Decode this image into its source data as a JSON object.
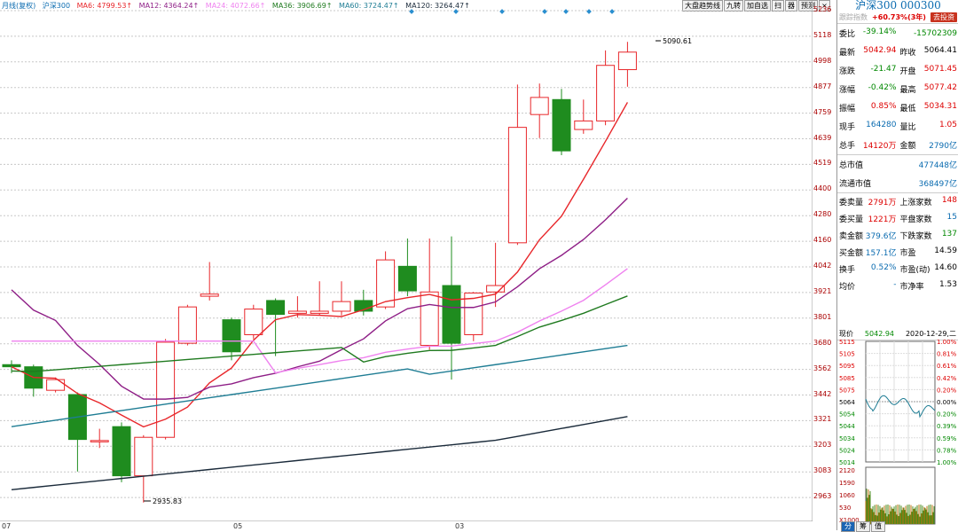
{
  "legend": {
    "period": "月线(复权)",
    "name": "沪深300",
    "ma6": "MA6: 4799.53↑",
    "ma12": "MA12: 4364.24↑",
    "ma24": "MA24: 4072.66↑",
    "ma36": "MA36: 3906.69↑",
    "ma60": "MA60: 3724.47↑",
    "ma120": "MA120: 3264.47↑"
  },
  "toolbar": {
    "btn1": "大盘趋势线",
    "btn2": "九转",
    "btn3": "加自选",
    "btn4": "扫",
    "btn5": "器",
    "btn6": "预测",
    "close": "×"
  },
  "price_axis": [
    "5236",
    "5118",
    "4998",
    "4877",
    "4759",
    "4639",
    "4519",
    "4400",
    "4280",
    "4160",
    "4042",
    "3921",
    "3801",
    "3680",
    "3562",
    "3442",
    "3321",
    "3203",
    "3083",
    "2963"
  ],
  "x_labels": {
    "a": "07",
    "b": "05",
    "c": "03"
  },
  "annotations": {
    "high": "5090.61",
    "low": "2935.83"
  },
  "chart_data": {
    "type": "candlestick",
    "ylim": [
      2900,
      5240
    ],
    "candles": [
      {
        "o": 3580,
        "c": 3570,
        "h": 3600,
        "l": 3540
      },
      {
        "o": 3570,
        "c": 3470,
        "h": 3580,
        "l": 3430
      },
      {
        "o": 3460,
        "c": 3510,
        "h": 3520,
        "l": 3450
      },
      {
        "o": 3440,
        "c": 3230,
        "h": 3450,
        "l": 3080
      },
      {
        "o": 3220,
        "c": 3225,
        "h": 3280,
        "l": 3190
      },
      {
        "o": 3290,
        "c": 3060,
        "h": 3310,
        "l": 3030
      },
      {
        "o": 3060,
        "c": 3240,
        "h": 3250,
        "l": 2935
      },
      {
        "o": 3240,
        "c": 3685,
        "h": 3700,
        "l": 3230
      },
      {
        "o": 3680,
        "c": 3850,
        "h": 3860,
        "l": 3670
      },
      {
        "o": 3900,
        "c": 3910,
        "h": 4060,
        "l": 3880
      },
      {
        "o": 3790,
        "c": 3640,
        "h": 3800,
        "l": 3600
      },
      {
        "o": 3720,
        "c": 3840,
        "h": 3860,
        "l": 3700
      },
      {
        "o": 3880,
        "c": 3815,
        "h": 3890,
        "l": 3620
      },
      {
        "o": 3820,
        "c": 3830,
        "h": 3900,
        "l": 3800
      },
      {
        "o": 3820,
        "c": 3830,
        "h": 3970,
        "l": 3810
      },
      {
        "o": 3830,
        "c": 3875,
        "h": 3970,
        "l": 3810
      },
      {
        "o": 3880,
        "c": 3830,
        "h": 3930,
        "l": 3810
      },
      {
        "o": 3850,
        "c": 4070,
        "h": 4110,
        "l": 3840
      },
      {
        "o": 4040,
        "c": 3925,
        "h": 4170,
        "l": 3900
      },
      {
        "o": 3670,
        "c": 3920,
        "h": 4170,
        "l": 3650
      },
      {
        "o": 3950,
        "c": 3680,
        "h": 4180,
        "l": 3510
      },
      {
        "o": 3720,
        "c": 3915,
        "h": 3920,
        "l": 3690
      },
      {
        "o": 3920,
        "c": 3950,
        "h": 4150,
        "l": 3850
      },
      {
        "o": 4150,
        "c": 4690,
        "h": 4890,
        "l": 4140
      },
      {
        "o": 4750,
        "c": 4830,
        "h": 4895,
        "l": 4640
      },
      {
        "o": 4820,
        "c": 4580,
        "h": 4870,
        "l": 4560
      },
      {
        "o": 4680,
        "c": 4720,
        "h": 4820,
        "l": 4660
      },
      {
        "o": 4720,
        "c": 4980,
        "h": 5050,
        "l": 4700
      },
      {
        "o": 4960,
        "c": 5042,
        "h": 5090,
        "l": 4880
      }
    ],
    "ma_colors": {
      "ma6": "#e8262a",
      "ma12": "#8e1e86",
      "ma24": "#ef82ef",
      "ma36": "#1f7a1f",
      "ma60": "#1f7d94",
      "ma120": "#1a2a3a"
    }
  },
  "panel": {
    "title": "沪深300 000300",
    "sub_index": "跟踪指数",
    "sub_change": "+60.73%(3年)",
    "sub_button": "去投资",
    "rows": [
      {
        "l1": "委比",
        "v1": "-39.14%",
        "l2": "",
        "v2": "-15702309"
      },
      {
        "l1": "最新",
        "v1": "5042.94",
        "l2": "昨收",
        "v2": "5064.41"
      },
      {
        "l1": "涨跌",
        "v1": "-21.47",
        "l2": "开盘",
        "v2": "5071.45"
      },
      {
        "l1": "涨幅",
        "v1": "-0.42%",
        "l2": "最高",
        "v2": "5077.42"
      },
      {
        "l1": "振幅",
        "v1": "0.85%",
        "l2": "最低",
        "v2": "5034.31"
      },
      {
        "l1": "现手",
        "v1": "164280",
        "l2": "量比",
        "v2": "1.05"
      },
      {
        "l1": "总手",
        "v1": "14120万",
        "l2": "金额",
        "v2": "2790亿"
      }
    ],
    "mkt": [
      {
        "l": "总市值",
        "v": "477448亿"
      },
      {
        "l": "流通市值",
        "v": "368497亿"
      }
    ],
    "rows2": [
      {
        "l1": "委卖量",
        "v1": "2791万",
        "l2": "上涨家数",
        "v2": "148"
      },
      {
        "l1": "委买量",
        "v1": "1221万",
        "l2": "平盘家数",
        "v2": "15"
      },
      {
        "l1": "卖金额",
        "v1": "379.6亿",
        "l2": "下跌家数",
        "v2": "137"
      },
      {
        "l1": "买金额",
        "v1": "157.1亿",
        "l2": "市盈",
        "v2": "14.59"
      },
      {
        "l1": "换手",
        "v1": "0.52%",
        "l2": "市盈(动)",
        "v2": "14.60"
      },
      {
        "l1": "均价",
        "v1": "-",
        "l2": "市净率",
        "v2": "1.53"
      }
    ],
    "minute_header": {
      "label": "现价",
      "price": "5042.94",
      "date": "2020-12-29,二"
    },
    "minute_prices": [
      "5115",
      "5105",
      "5095",
      "5085",
      "5075",
      "5064",
      "5054",
      "5044",
      "5034",
      "5024",
      "5014"
    ],
    "minute_pcts": [
      "1.00%",
      "0.81%",
      "0.61%",
      "0.42%",
      "0.20%",
      "0.00%",
      "0.20%",
      "0.39%",
      "0.59%",
      "0.78%",
      "1.00%"
    ],
    "volume_labels": [
      "2120",
      "1590",
      "1060",
      "530",
      "X1000"
    ],
    "tabs": [
      "分",
      "筹",
      "值"
    ]
  }
}
